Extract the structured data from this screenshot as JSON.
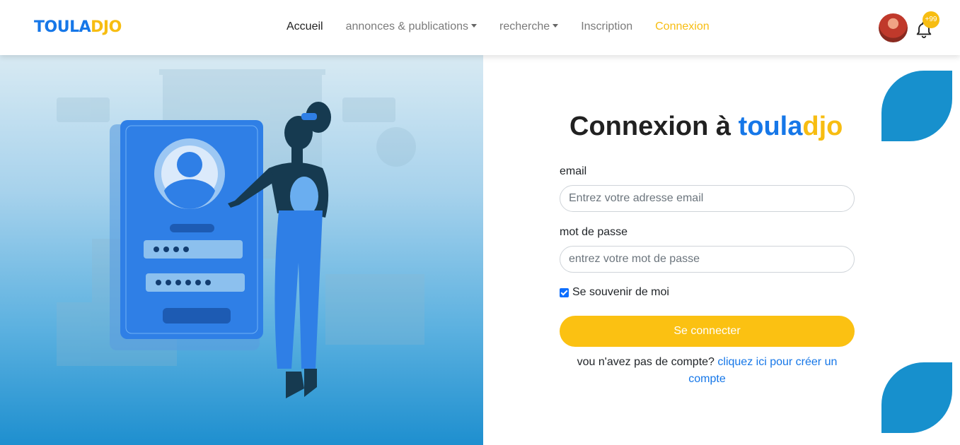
{
  "brand": {
    "part1": "TOULA",
    "part2": "DJO"
  },
  "nav": {
    "home": "Accueil",
    "announcements": "annonces & publications",
    "search": "recherche",
    "register": "Inscription",
    "login": "Connexion"
  },
  "notifications": {
    "count": "+99",
    "icon": "bell-icon"
  },
  "form": {
    "title_prefix": "Connexion à ",
    "title_brand1": "toula",
    "title_brand2": "djo",
    "email_label": "email",
    "email_placeholder": "Entrez votre adresse email",
    "password_label": "mot de passe",
    "password_placeholder": "entrez votre mot de passe",
    "remember_label": "Se souvenir de moi",
    "remember_checked": true,
    "submit_label": "Se connecter",
    "signup_text": "vou n'avez pas de compte?",
    "signup_link": "cliquez ici pour créer un compte"
  },
  "colors": {
    "primary": "#1677e8",
    "accent": "#f7bd12",
    "blob": "#1790cd"
  }
}
